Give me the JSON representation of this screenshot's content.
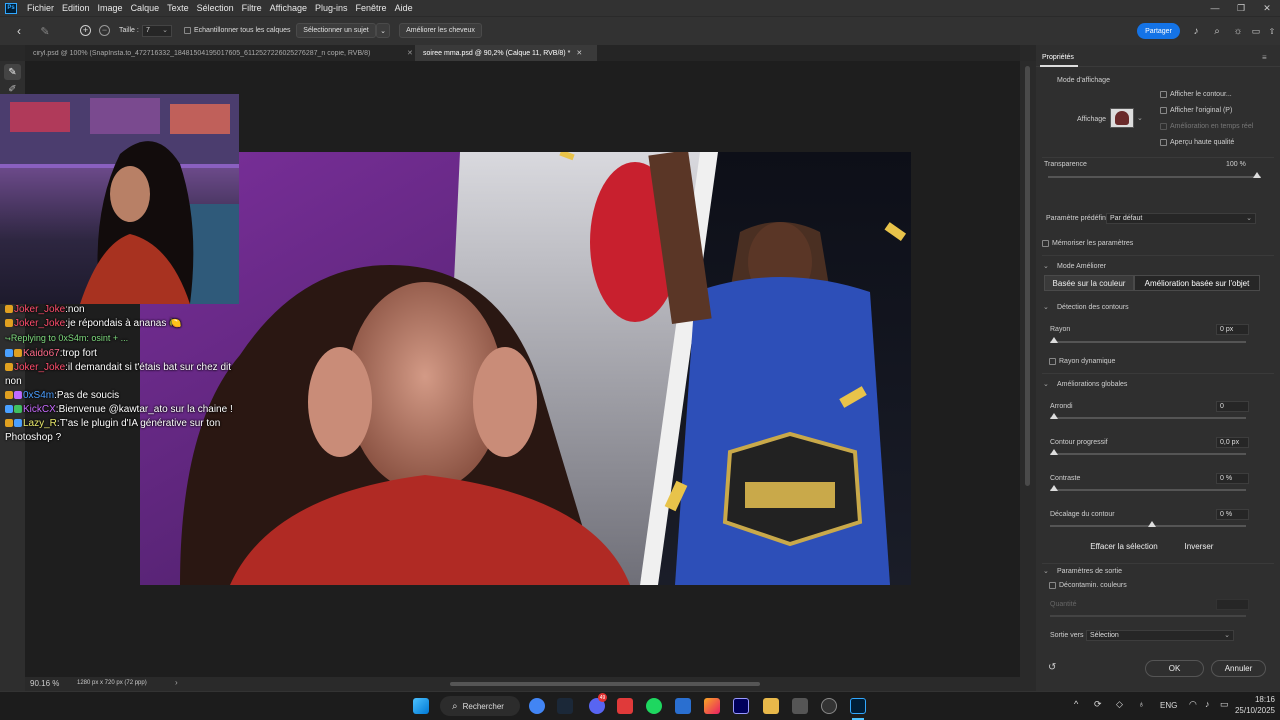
{
  "app": {
    "logo_text": "Ps"
  },
  "menu": {
    "items": [
      "Fichier",
      "Edition",
      "Image",
      "Calque",
      "Texte",
      "Sélection",
      "Filtre",
      "Affichage",
      "Plug-ins",
      "Fenêtre",
      "Aide"
    ]
  },
  "window_controls": {
    "minimize": "—",
    "restore": "❐",
    "close": "✕"
  },
  "options_bar": {
    "size_label": "Taille :",
    "size_value": "7",
    "sample_all_layers": "Echantillonner tous les calques",
    "select_subject": "Sélectionner un sujet",
    "refine_hair": "Améliorer les cheveux",
    "share": "Partager"
  },
  "tabs": [
    {
      "label": "ciryl.psd @ 100% (SnapInsta.to_472716332_18481504195017605_6112527226025276287_n copie, RVB/8)",
      "active": false
    },
    {
      "label": "soiree mma.psd @ 90,2% (Calque 11, RVB/8) *",
      "active": true
    }
  ],
  "chat": {
    "messages": [
      {
        "user": "",
        "user_color": "#ff4444",
        "text": "non"
      },
      {
        "user": "Joker_Joke",
        "user_color": "#ff4d6d",
        "text": "je répondais à ananas 🍋"
      },
      {
        "user": "",
        "user_color": "#7fdc7f",
        "text": "Replying to 0xS4m: osint + ..."
      },
      {
        "user": "Kaido67",
        "user_color": "#ff6b8a",
        "text": "trop fort"
      },
      {
        "user": "Joker_Joke",
        "user_color": "#ff4d6d",
        "text": "il demandait si t'étais bat sur chez dit non"
      },
      {
        "user": "0xS4m",
        "user_color": "#4a9eff",
        "text": "Pas de soucis"
      },
      {
        "user": "KickCX",
        "user_color": "#c86bff",
        "text": "Bienvenue @kawtar_ato sur la chaine !"
      },
      {
        "user": "Lazy_R",
        "user_color": "#e8e86b",
        "text": "T'as le plugin d'IA générative sur ton Photoshop ?"
      }
    ]
  },
  "status_bar": {
    "zoom": "90.16 %",
    "doc_info": "1280 px x 720 px (72 ppp)"
  },
  "panel": {
    "title": "Propriétés",
    "view_mode": "Mode d'affichage",
    "display_label": "Affichage",
    "show_edges": "Afficher le contour...",
    "show_original": "Afficher l'original (P)",
    "realtime": "Amélioration en temps réel",
    "high_quality": "Aperçu haute qualité",
    "transparency_label": "Transparence",
    "transparency_value": "100 %",
    "transparency_level": 1.0,
    "preset_label": "Paramètre prédéfini",
    "preset_value": "Par défaut",
    "remember": "Mémoriser les paramètres",
    "refine_mode": "Mode Améliorer",
    "color_aware": "Basée sur la couleur",
    "object_aware": "Amélioration basée sur l'objet",
    "edge_detection": "Détection des contours",
    "radius_label": "Rayon",
    "radius_value": "0 px",
    "smart_radius": "Rayon dynamique",
    "global_refinements": "Améliorations globales",
    "smooth_label": "Arrondi",
    "smooth_value": "0",
    "feather_label": "Contour progressif",
    "feather_value": "0,0 px",
    "contrast_label": "Contraste",
    "contrast_value": "0 %",
    "shift_label": "Décalage du contour",
    "shift_value": "0 %",
    "shift_level": 0.5,
    "clear_selection": "Effacer la sélection",
    "invert": "Inverser",
    "output_settings": "Paramètres de sortie",
    "decontaminate": "Décontamin. couleurs",
    "quantity_label": "Quantité",
    "output_to_label": "Sortie vers",
    "output_to_value": "Sélection",
    "ok": "OK",
    "cancel": "Annuler"
  },
  "taskbar": {
    "search": "Rechercher",
    "lang": "ENG",
    "time": "18:16",
    "date": "25/10/2025",
    "badges": {
      "discord": "49"
    }
  },
  "colors": {
    "accent": "#1473e6",
    "panel_bg": "#2f2f2f",
    "menu_bg": "#323232"
  }
}
